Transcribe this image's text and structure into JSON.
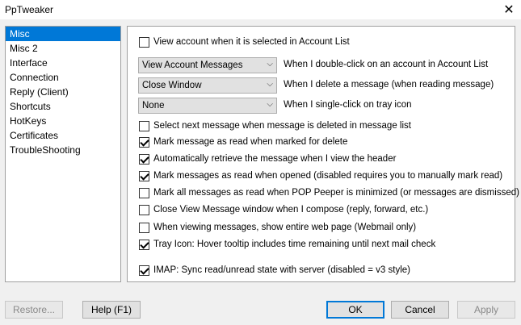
{
  "window": {
    "title": "PpTweaker",
    "close_glyph": "✕"
  },
  "sidebar": {
    "items": [
      {
        "label": "Misc",
        "active": true
      },
      {
        "label": "Misc 2"
      },
      {
        "label": "Interface"
      },
      {
        "label": "Connection"
      },
      {
        "label": "Reply (Client)"
      },
      {
        "label": "Shortcuts"
      },
      {
        "label": "HotKeys"
      },
      {
        "label": "Certificates"
      },
      {
        "label": "TroubleShooting"
      }
    ]
  },
  "panel": {
    "view_account": {
      "label": "View account when it is selected in Account List",
      "checked": false
    },
    "combos": [
      {
        "value": "View Account Messages",
        "label": "When I double-click on an account in Account List"
      },
      {
        "value": "Close Window",
        "label": "When I delete a message (when reading message)"
      },
      {
        "value": "None",
        "label": "When I single-click on tray icon"
      }
    ],
    "options": [
      {
        "label": "Select next message when message is deleted in message list",
        "checked": false
      },
      {
        "label": "Mark message as read when marked for delete",
        "checked": true
      },
      {
        "label": "Automatically retrieve the message when I view the header",
        "checked": true
      },
      {
        "label": "Mark messages as read when opened (disabled requires you to manually mark read)",
        "checked": true
      },
      {
        "label": "Mark all messages as read when POP Peeper is minimized (or messages are dismissed)",
        "checked": false
      },
      {
        "label": "Close View Message window when I compose (reply, forward, etc.)",
        "checked": false
      },
      {
        "label": "When viewing messages, show entire web page (Webmail only)",
        "checked": false
      },
      {
        "label": "Tray Icon: Hover tooltip includes time remaining until next mail check",
        "checked": true
      },
      {
        "label": "IMAP: Sync read/unread state with server (disabled = v3 style)",
        "checked": true
      }
    ]
  },
  "buttons": {
    "restore": "Restore...",
    "help": "Help (F1)",
    "ok": "OK",
    "cancel": "Cancel",
    "apply": "Apply"
  },
  "colors": {
    "selection": "#0078d7",
    "default_button_border": "#0078d7"
  },
  "icons": {
    "combo_chevron": "chevron-down-icon"
  }
}
